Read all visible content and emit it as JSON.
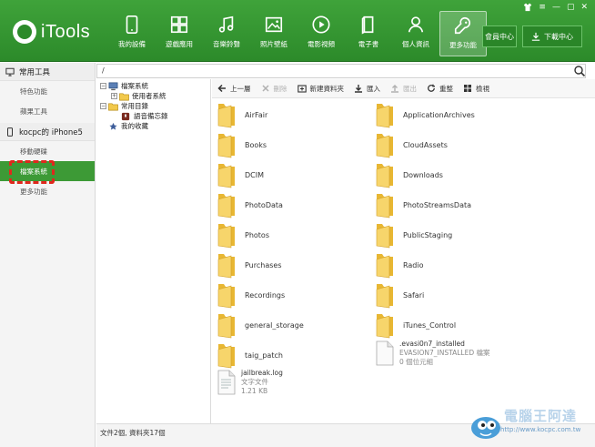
{
  "app": {
    "name": "iTools"
  },
  "window_controls": {
    "shirt": "shirt-icon",
    "menu": "≡",
    "minimize": "—",
    "maximize": "▢",
    "close": "✕"
  },
  "nav": [
    {
      "label": "我的設備",
      "icon": "phone-icon"
    },
    {
      "label": "遊戲應用",
      "icon": "apps-icon"
    },
    {
      "label": "音樂鈴聲",
      "icon": "music-icon"
    },
    {
      "label": "照片壁紙",
      "icon": "photo-icon"
    },
    {
      "label": "電影視頻",
      "icon": "play-icon"
    },
    {
      "label": "電子書",
      "icon": "book-icon"
    },
    {
      "label": "個人資訊",
      "icon": "person-icon"
    },
    {
      "label": "更多功能",
      "icon": "wrench-icon",
      "active": true
    }
  ],
  "top_buttons": {
    "member": "會員中心",
    "download": "下載中心"
  },
  "sidebar": {
    "section1_title": "常用工具",
    "section1_items": [
      "特色功能",
      "蘋果工具"
    ],
    "device_title": "kocpc的 iPhone5",
    "device_items": [
      "移動硬碟",
      "檔案系統",
      "更多功能"
    ],
    "active_index": 1
  },
  "path": "/",
  "tree": {
    "file_system": "檔案系統",
    "user_system": "使用者系統",
    "common_dir": "常用目錄",
    "voice_memo": "語音備忘錄",
    "favorites": "我的收藏",
    "toggle_minus": "−",
    "toggle_plus": "+"
  },
  "toolbar": {
    "back": "上一層",
    "delete": "刪除",
    "new_folder": "新建資料夾",
    "import": "匯入",
    "export": "匯出",
    "refresh": "重整",
    "view": "檢視"
  },
  "files": [
    {
      "name": "AirFair",
      "type": "folder"
    },
    {
      "name": "ApplicationArchives",
      "type": "folder"
    },
    {
      "name": "Books",
      "type": "folder"
    },
    {
      "name": "CloudAssets",
      "type": "folder"
    },
    {
      "name": "DCIM",
      "type": "folder"
    },
    {
      "name": "Downloads",
      "type": "folder"
    },
    {
      "name": "PhotoData",
      "type": "folder"
    },
    {
      "name": "PhotoStreamsData",
      "type": "folder"
    },
    {
      "name": "Photos",
      "type": "folder"
    },
    {
      "name": "PublicStaging",
      "type": "folder"
    },
    {
      "name": "Purchases",
      "type": "folder"
    },
    {
      "name": "Radio",
      "type": "folder"
    },
    {
      "name": "Recordings",
      "type": "folder"
    },
    {
      "name": "Safari",
      "type": "folder"
    },
    {
      "name": "general_storage",
      "type": "folder"
    },
    {
      "name": "iTunes_Control",
      "type": "folder"
    },
    {
      "name": "taig_patch",
      "type": "folder"
    },
    {
      "name": ".evasi0n7_installed",
      "type": "file",
      "kind": "EVASION7_INSTALLED 檔案",
      "size": "0 個位元組"
    },
    {
      "name": "jailbreak.log",
      "type": "file",
      "kind": "文字文件",
      "size": "1.21 KB"
    }
  ],
  "status": "文件2個, 資料夾17個",
  "watermark": {
    "brand": "電腦王阿達",
    "url": "http://www.kocpc.com.tw"
  },
  "colors": {
    "brand_green": "#3d9a36",
    "highlight_red": "#e0281d",
    "folder_yellow": "#f2c94c"
  }
}
